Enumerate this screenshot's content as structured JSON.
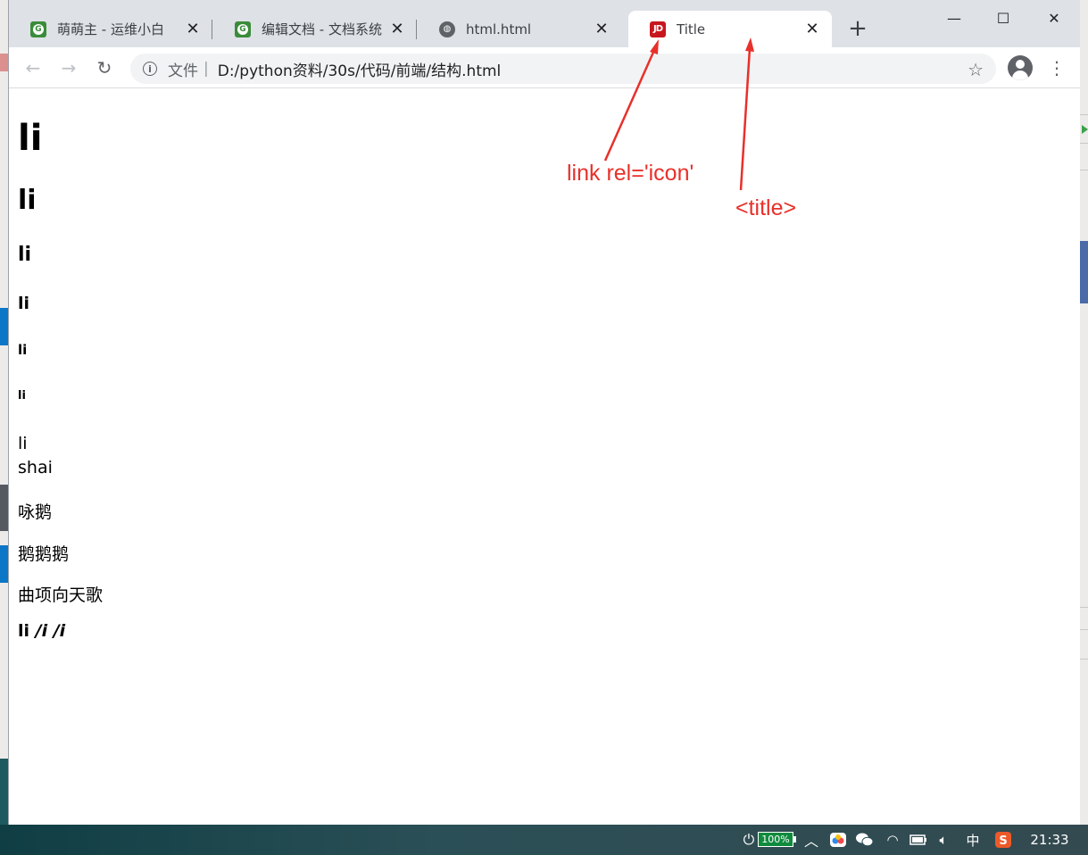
{
  "browser": {
    "tabs": [
      {
        "label": "萌萌主 - 运维小白",
        "favicon": "green-g-icon",
        "active": false
      },
      {
        "label": "编辑文档 - 文档系统",
        "favicon": "green-g-icon",
        "active": false
      },
      {
        "label": "html.html",
        "favicon": "globe-icon",
        "active": false
      },
      {
        "label": "Title",
        "favicon": "jd-icon",
        "active": true
      }
    ],
    "favicon_text": {
      "g": "G",
      "jd": "JD"
    },
    "new_tab_glyph": "+",
    "address": {
      "scheme": "文件",
      "separator": "|",
      "url": "D:/python资料/30s/代码/前端/结构.html"
    }
  },
  "page": {
    "h1": "li",
    "h2": "li",
    "h3": "li",
    "h4": "li",
    "h5": "li",
    "h6": "li",
    "line1": "li",
    "line2": "shai",
    "p1": "咏鹅",
    "p2": "鹅鹅鹅",
    "p3": "曲项向天歌",
    "p4_a": "li ",
    "p4_b": "/i",
    "p4_c": " /i"
  },
  "annotations": {
    "icon_label": "link rel='icon'",
    "title_label": "<title>",
    "color": "#e8302a"
  },
  "taskbar": {
    "battery": "100%",
    "ime": "中",
    "time": "21:33"
  }
}
